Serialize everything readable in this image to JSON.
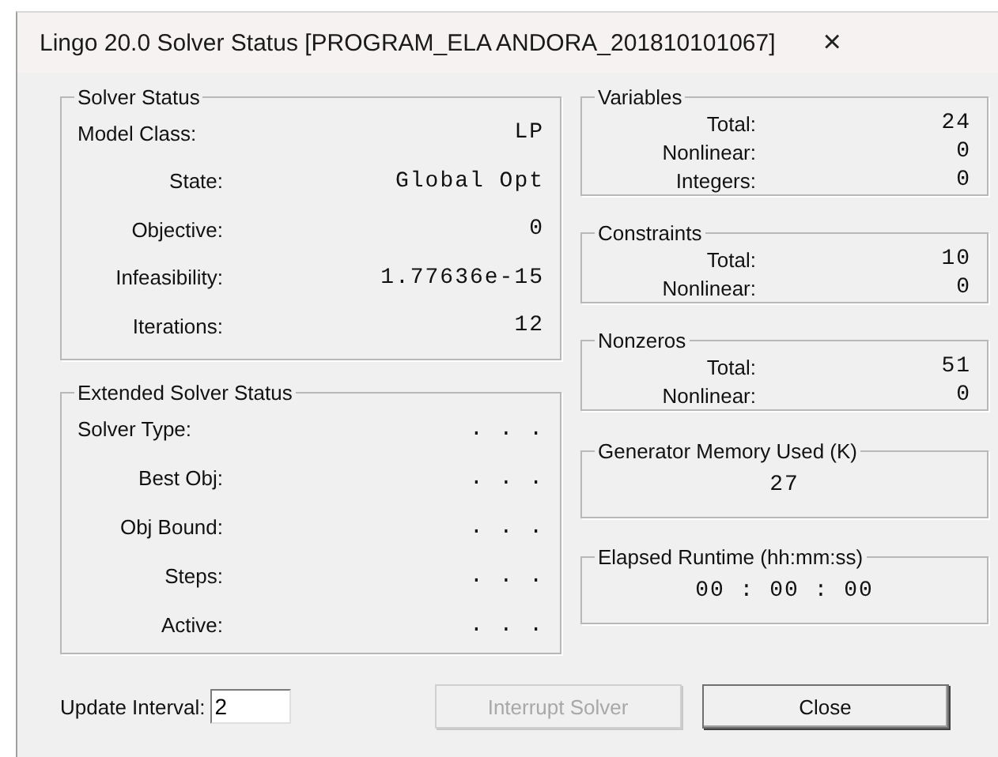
{
  "window": {
    "title": "Lingo 20.0 Solver Status [PROGRAM_ELA ANDORA_201810101067]",
    "close": "×"
  },
  "solver_status": {
    "title": "Solver Status",
    "rows": [
      {
        "label": "Model Class:",
        "value": "LP"
      },
      {
        "label": "State:",
        "value": "Global Opt"
      },
      {
        "label": "Objective:",
        "value": "0"
      },
      {
        "label": "Infeasibility:",
        "value": "1.77636e-15"
      },
      {
        "label": "Iterations:",
        "value": "12"
      }
    ]
  },
  "extended_status": {
    "title": "Extended Solver Status",
    "rows": [
      {
        "label": "Solver Type:",
        "value": ". . ."
      },
      {
        "label": "Best Obj:",
        "value": ". . ."
      },
      {
        "label": "Obj Bound:",
        "value": ". . ."
      },
      {
        "label": "Steps:",
        "value": ". . ."
      },
      {
        "label": "Active:",
        "value": ". . ."
      }
    ]
  },
  "counts": [
    {
      "title": "Variables",
      "rows": [
        {
          "label": "Total:",
          "value": "24"
        },
        {
          "label": "Nonlinear:",
          "value": "0"
        },
        {
          "label": "Integers:",
          "value": "0"
        }
      ]
    },
    {
      "title": "Constraints",
      "rows": [
        {
          "label": "Total:",
          "value": "10"
        },
        {
          "label": "Nonlinear:",
          "value": "0"
        }
      ]
    },
    {
      "title": "Nonzeros",
      "rows": [
        {
          "label": "Total:",
          "value": "51"
        },
        {
          "label": "Nonlinear:",
          "value": "0"
        }
      ]
    }
  ],
  "readouts": [
    {
      "title": "Generator Memory Used (K)",
      "value": "27"
    },
    {
      "title": "Elapsed Runtime (hh:mm:ss)",
      "value": "00 : 00 : 00"
    }
  ],
  "update_interval": {
    "label": "Update Interval:",
    "value": "2"
  },
  "buttons": [
    {
      "label": "Interrupt Solver",
      "disabled": true
    },
    {
      "label": "Close",
      "disabled": false
    }
  ]
}
